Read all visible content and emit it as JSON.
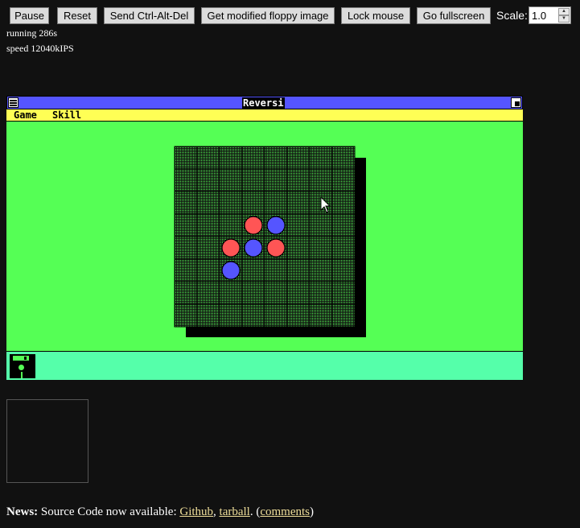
{
  "toolbar": {
    "pause": "Pause",
    "reset": "Reset",
    "ctrl_alt_del": "Send Ctrl-Alt-Del",
    "floppy_image": "Get modified floppy image",
    "lock_mouse": "Lock mouse",
    "fullscreen": "Go fullscreen",
    "scale_label": "Scale:",
    "scale_value": "1.0"
  },
  "status": {
    "running": "running 286s",
    "speed": "speed 12040kIPS"
  },
  "window": {
    "title": "Reversi",
    "menu": [
      "Game",
      "Skill"
    ]
  },
  "game": {
    "board_size": 8,
    "pieces": [
      {
        "row": 3,
        "col": 3,
        "color": "red"
      },
      {
        "row": 3,
        "col": 4,
        "color": "blue"
      },
      {
        "row": 4,
        "col": 2,
        "color": "red"
      },
      {
        "row": 4,
        "col": 3,
        "color": "blue"
      },
      {
        "row": 4,
        "col": 4,
        "color": "red"
      },
      {
        "row": 5,
        "col": 2,
        "color": "blue"
      }
    ]
  },
  "news": {
    "label": "News:",
    "text": "Source Code now available:",
    "link_github": "Github",
    "link_tarball": "tarball",
    "link_comments": "comments"
  },
  "colors": {
    "desktop": "#55ff55",
    "titlebar": "#5555ff",
    "menubar": "#ffff55",
    "red_piece": "#ff5555",
    "blue_piece": "#5555ff",
    "iconbar": "#55ffaa"
  }
}
